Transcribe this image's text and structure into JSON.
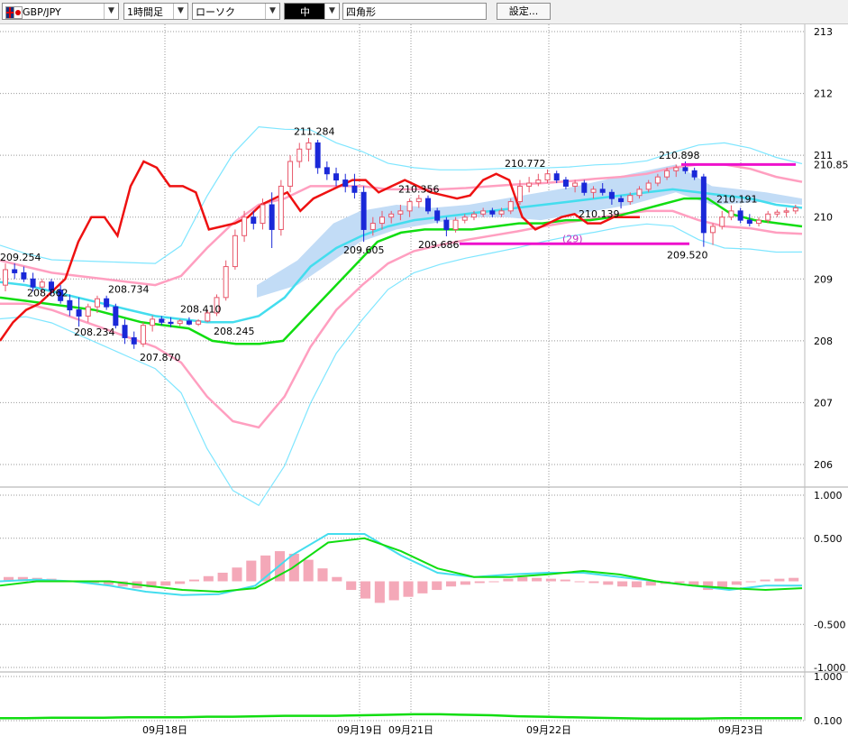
{
  "toolbar": {
    "symbol": "GBP/JPY",
    "timeframe": "1時間足",
    "chart_style": "ローソク",
    "draw_color_label": "中",
    "draw_shape": "四角形",
    "settings_label": "設定..."
  },
  "colors": {
    "candle_up": "#e8566a",
    "candle_down": "#1a28d8",
    "price_line": "#ee1111",
    "bollinger_outer": "#7fe6ff",
    "bollinger_inner": "#ff9fc0",
    "moving_average_long": "#11dd11",
    "moving_average_short": "#44ddee",
    "cloud": "#c2dcf6",
    "macd_histogram": "#f4a8b8",
    "marker_line": "#ee11cc"
  },
  "chart_data": [
    {
      "type": "line",
      "panel": "price",
      "ylim": [
        206,
        213
      ],
      "yticks": [
        "213",
        "212",
        "211",
        "210",
        "209",
        "208",
        "207",
        "206"
      ],
      "current_price_label": "210.85",
      "xticks": [
        "09月18日",
        "09月19日",
        "09月21日",
        "09月22日",
        "09月23日"
      ],
      "price_labels": [
        {
          "text": "209.254",
          "value": 209.254
        },
        {
          "text": "208.862",
          "value": 208.862
        },
        {
          "text": "208.734",
          "value": 208.734
        },
        {
          "text": "208.234",
          "value": 208.234
        },
        {
          "text": "208.410",
          "value": 208.41
        },
        {
          "text": "207.870",
          "value": 207.87
        },
        {
          "text": "208.245",
          "value": 208.245
        },
        {
          "text": "211.284",
          "value": 211.284
        },
        {
          "text": "209.605",
          "value": 209.605
        },
        {
          "text": "210.356",
          "value": 210.356
        },
        {
          "text": "209.686",
          "value": 209.686
        },
        {
          "text": "210.772",
          "value": 210.772
        },
        {
          "text": "210.139",
          "value": 210.139
        },
        {
          "text": "210.898",
          "value": 210.898
        },
        {
          "text": "209.520",
          "value": 209.52
        },
        {
          "text": "210.191",
          "value": 210.191
        }
      ],
      "annotation": "(29)",
      "horizontal_markers": [
        210.85,
        209.57
      ],
      "candles": [
        {
          "o": 208.9,
          "h": 209.25,
          "l": 208.8,
          "c": 209.15
        },
        {
          "o": 209.15,
          "h": 209.25,
          "l": 209.0,
          "c": 209.1
        },
        {
          "o": 209.1,
          "h": 209.2,
          "l": 208.95,
          "c": 209.0
        },
        {
          "o": 209.0,
          "h": 209.1,
          "l": 208.8,
          "c": 208.87
        },
        {
          "o": 208.87,
          "h": 209.0,
          "l": 208.78,
          "c": 208.95
        },
        {
          "o": 208.95,
          "h": 209.0,
          "l": 208.75,
          "c": 208.82
        },
        {
          "o": 208.82,
          "h": 208.9,
          "l": 208.6,
          "c": 208.65
        },
        {
          "o": 208.65,
          "h": 208.75,
          "l": 208.4,
          "c": 208.5
        },
        {
          "o": 208.5,
          "h": 208.7,
          "l": 208.23,
          "c": 208.4
        },
        {
          "o": 208.4,
          "h": 208.6,
          "l": 208.3,
          "c": 208.55
        },
        {
          "o": 208.55,
          "h": 208.73,
          "l": 208.45,
          "c": 208.68
        },
        {
          "o": 208.68,
          "h": 208.73,
          "l": 208.5,
          "c": 208.55
        },
        {
          "o": 208.55,
          "h": 208.6,
          "l": 208.2,
          "c": 208.25
        },
        {
          "o": 208.25,
          "h": 208.35,
          "l": 207.95,
          "c": 208.05
        },
        {
          "o": 208.05,
          "h": 208.15,
          "l": 207.87,
          "c": 207.95
        },
        {
          "o": 207.95,
          "h": 208.3,
          "l": 207.9,
          "c": 208.25
        },
        {
          "o": 208.25,
          "h": 208.41,
          "l": 208.15,
          "c": 208.35
        },
        {
          "o": 208.35,
          "h": 208.4,
          "l": 208.25,
          "c": 208.3
        },
        {
          "o": 208.3,
          "h": 208.38,
          "l": 208.22,
          "c": 208.28
        },
        {
          "o": 208.28,
          "h": 208.35,
          "l": 208.24,
          "c": 208.32
        },
        {
          "o": 208.32,
          "h": 208.38,
          "l": 208.25,
          "c": 208.27
        },
        {
          "o": 208.27,
          "h": 208.35,
          "l": 208.24,
          "c": 208.32
        },
        {
          "o": 208.32,
          "h": 208.5,
          "l": 208.3,
          "c": 208.45
        },
        {
          "o": 208.45,
          "h": 208.75,
          "l": 208.4,
          "c": 208.7
        },
        {
          "o": 208.7,
          "h": 209.3,
          "l": 208.65,
          "c": 209.2
        },
        {
          "o": 209.2,
          "h": 209.8,
          "l": 209.15,
          "c": 209.7
        },
        {
          "o": 209.7,
          "h": 210.1,
          "l": 209.6,
          "c": 210.0
        },
        {
          "o": 210.0,
          "h": 210.1,
          "l": 209.8,
          "c": 209.9
        },
        {
          "o": 209.9,
          "h": 210.3,
          "l": 209.8,
          "c": 210.2
        },
        {
          "o": 210.2,
          "h": 210.4,
          "l": 209.5,
          "c": 209.8
        },
        {
          "o": 209.8,
          "h": 210.6,
          "l": 209.7,
          "c": 210.5
        },
        {
          "o": 210.5,
          "h": 211.0,
          "l": 210.4,
          "c": 210.9
        },
        {
          "o": 210.9,
          "h": 211.2,
          "l": 210.8,
          "c": 211.1
        },
        {
          "o": 211.1,
          "h": 211.28,
          "l": 210.9,
          "c": 211.2
        },
        {
          "o": 211.2,
          "h": 211.25,
          "l": 210.7,
          "c": 210.8
        },
        {
          "o": 210.8,
          "h": 210.9,
          "l": 210.6,
          "c": 210.7
        },
        {
          "o": 210.7,
          "h": 210.8,
          "l": 210.5,
          "c": 210.6
        },
        {
          "o": 210.6,
          "h": 210.7,
          "l": 210.4,
          "c": 210.5
        },
        {
          "o": 210.5,
          "h": 210.7,
          "l": 210.3,
          "c": 210.4
        },
        {
          "o": 210.4,
          "h": 210.5,
          "l": 209.6,
          "c": 209.8
        },
        {
          "o": 209.8,
          "h": 210.0,
          "l": 209.7,
          "c": 209.9
        },
        {
          "o": 209.9,
          "h": 210.1,
          "l": 209.8,
          "c": 210.0
        },
        {
          "o": 210.0,
          "h": 210.1,
          "l": 209.9,
          "c": 210.05
        },
        {
          "o": 210.05,
          "h": 210.2,
          "l": 209.95,
          "c": 210.1
        },
        {
          "o": 210.1,
          "h": 210.3,
          "l": 210.0,
          "c": 210.25
        },
        {
          "o": 210.25,
          "h": 210.36,
          "l": 210.15,
          "c": 210.3
        },
        {
          "o": 210.3,
          "h": 210.35,
          "l": 210.05,
          "c": 210.1
        },
        {
          "o": 210.1,
          "h": 210.15,
          "l": 209.9,
          "c": 209.95
        },
        {
          "o": 209.95,
          "h": 210.0,
          "l": 209.69,
          "c": 209.8
        },
        {
          "o": 209.8,
          "h": 210.0,
          "l": 209.75,
          "c": 209.95
        },
        {
          "o": 209.95,
          "h": 210.05,
          "l": 209.9,
          "c": 210.0
        },
        {
          "o": 210.0,
          "h": 210.1,
          "l": 209.95,
          "c": 210.05
        },
        {
          "o": 210.05,
          "h": 210.15,
          "l": 210.0,
          "c": 210.1
        },
        {
          "o": 210.1,
          "h": 210.15,
          "l": 210.0,
          "c": 210.05
        },
        {
          "o": 210.05,
          "h": 210.15,
          "l": 210.0,
          "c": 210.1
        },
        {
          "o": 210.1,
          "h": 210.3,
          "l": 210.05,
          "c": 210.25
        },
        {
          "o": 210.25,
          "h": 210.6,
          "l": 210.2,
          "c": 210.5
        },
        {
          "o": 210.5,
          "h": 210.65,
          "l": 210.4,
          "c": 210.55
        },
        {
          "o": 210.55,
          "h": 210.7,
          "l": 210.5,
          "c": 210.6
        },
        {
          "o": 210.6,
          "h": 210.77,
          "l": 210.55,
          "c": 210.7
        },
        {
          "o": 210.7,
          "h": 210.75,
          "l": 210.55,
          "c": 210.6
        },
        {
          "o": 210.6,
          "h": 210.65,
          "l": 210.45,
          "c": 210.5
        },
        {
          "o": 210.5,
          "h": 210.6,
          "l": 210.4,
          "c": 210.55
        },
        {
          "o": 210.55,
          "h": 210.6,
          "l": 210.35,
          "c": 210.4
        },
        {
          "o": 210.4,
          "h": 210.5,
          "l": 210.3,
          "c": 210.45
        },
        {
          "o": 210.45,
          "h": 210.55,
          "l": 210.35,
          "c": 210.4
        },
        {
          "o": 210.4,
          "h": 210.45,
          "l": 210.2,
          "c": 210.3
        },
        {
          "o": 210.3,
          "h": 210.35,
          "l": 210.14,
          "c": 210.25
        },
        {
          "o": 210.25,
          "h": 210.4,
          "l": 210.2,
          "c": 210.35
        },
        {
          "o": 210.35,
          "h": 210.5,
          "l": 210.3,
          "c": 210.45
        },
        {
          "o": 210.45,
          "h": 210.6,
          "l": 210.4,
          "c": 210.55
        },
        {
          "o": 210.55,
          "h": 210.7,
          "l": 210.5,
          "c": 210.65
        },
        {
          "o": 210.65,
          "h": 210.8,
          "l": 210.6,
          "c": 210.75
        },
        {
          "o": 210.75,
          "h": 210.85,
          "l": 210.65,
          "c": 210.8
        },
        {
          "o": 210.8,
          "h": 210.9,
          "l": 210.7,
          "c": 210.75
        },
        {
          "o": 210.75,
          "h": 210.8,
          "l": 210.6,
          "c": 210.65
        },
        {
          "o": 210.65,
          "h": 210.7,
          "l": 209.52,
          "c": 209.75
        },
        {
          "o": 209.75,
          "h": 209.9,
          "l": 209.55,
          "c": 209.85
        },
        {
          "o": 209.85,
          "h": 210.1,
          "l": 209.8,
          "c": 210.0
        },
        {
          "o": 210.0,
          "h": 210.19,
          "l": 209.95,
          "c": 210.1
        },
        {
          "o": 210.1,
          "h": 210.15,
          "l": 209.9,
          "c": 209.95
        },
        {
          "o": 209.95,
          "h": 210.05,
          "l": 209.85,
          "c": 209.9
        },
        {
          "o": 209.9,
          "h": 210.0,
          "l": 209.85,
          "c": 209.95
        },
        {
          "o": 209.95,
          "h": 210.1,
          "l": 209.9,
          "c": 210.05
        },
        {
          "o": 210.05,
          "h": 210.12,
          "l": 210.0,
          "c": 210.08
        },
        {
          "o": 210.08,
          "h": 210.15,
          "l": 210.0,
          "c": 210.1
        },
        {
          "o": 210.1,
          "h": 210.2,
          "l": 210.05,
          "c": 210.15
        }
      ],
      "series": [
        {
          "color": "#ee1111",
          "values": [
            208.0,
            208.3,
            208.5,
            208.6,
            208.8,
            209.0,
            209.6,
            210.0,
            210.0,
            209.7,
            210.5,
            210.9,
            210.8,
            210.5,
            210.5,
            210.4,
            209.8,
            209.85,
            209.9,
            210.0,
            210.2,
            210.3,
            210.4,
            210.1,
            210.3,
            210.4,
            210.5,
            210.6,
            210.6,
            210.4,
            210.5,
            210.6,
            210.5,
            210.4,
            210.35,
            210.3,
            210.35,
            210.6,
            210.7,
            210.6,
            210.0,
            209.8,
            209.9,
            210.0,
            210.05,
            209.9,
            209.9,
            210.0,
            210.0,
            210.0
          ]
        },
        {
          "color": "#11dd11",
          "values": [
            208.7,
            208.65,
            208.6,
            208.55,
            208.5,
            208.4,
            208.3,
            208.25,
            208.2,
            208.0,
            207.95,
            207.95,
            208.0,
            208.4,
            208.8,
            209.2,
            209.6,
            209.75,
            209.8,
            209.8,
            209.8,
            209.85,
            209.9,
            209.9,
            209.95,
            209.95,
            210.0,
            210.1,
            210.2,
            210.3,
            210.3,
            210.05,
            209.95,
            209.9,
            209.85
          ]
        },
        {
          "color": "#44ddee",
          "values": [
            208.95,
            208.9,
            208.8,
            208.7,
            208.6,
            208.5,
            208.4,
            208.35,
            208.3,
            208.3,
            208.4,
            208.7,
            209.2,
            209.5,
            209.7,
            209.85,
            209.95,
            210.0,
            210.05,
            210.1,
            210.15,
            210.2,
            210.25,
            210.3,
            210.35,
            210.4,
            210.45,
            210.4,
            210.35,
            210.3,
            210.2,
            210.15
          ]
        }
      ]
    },
    {
      "type": "line",
      "panel": "oscillator",
      "ylim": [
        -1.0,
        1.0
      ],
      "yticks": [
        "1.000",
        "0.500",
        "-0.500",
        "-1.000"
      ],
      "series": [
        {
          "color": "#44ddee",
          "values": [
            0.0,
            0.02,
            0.0,
            -0.05,
            -0.12,
            -0.16,
            -0.15,
            -0.05,
            0.3,
            0.55,
            0.55,
            0.3,
            0.1,
            0.05,
            0.08,
            0.1,
            0.1,
            0.05,
            0.0,
            -0.05,
            -0.1,
            -0.05,
            -0.05
          ]
        },
        {
          "color": "#11dd11",
          "values": [
            -0.05,
            0.0,
            0.0,
            0.0,
            -0.05,
            -0.1,
            -0.12,
            -0.08,
            0.15,
            0.45,
            0.5,
            0.35,
            0.15,
            0.05,
            0.05,
            0.08,
            0.12,
            0.08,
            0.0,
            -0.05,
            -0.08,
            -0.1,
            -0.08
          ]
        }
      ],
      "histogram": [
        0.05,
        0.05,
        0.04,
        0.03,
        0.01,
        0.0,
        -0.02,
        -0.04,
        -0.06,
        -0.08,
        -0.07,
        -0.05,
        -0.03,
        0.02,
        0.06,
        0.1,
        0.16,
        0.24,
        0.3,
        0.35,
        0.32,
        0.25,
        0.15,
        0.05,
        -0.1,
        -0.2,
        -0.25,
        -0.22,
        -0.18,
        -0.14,
        -0.1,
        -0.06,
        -0.04,
        -0.02,
        0.0,
        0.03,
        0.05,
        0.04,
        0.03,
        0.02,
        0.0,
        -0.02,
        -0.04,
        -0.06,
        -0.07,
        -0.05,
        -0.03,
        -0.02,
        -0.05,
        -0.1,
        -0.08,
        -0.04,
        0.0,
        0.02,
        0.03,
        0.04
      ]
    },
    {
      "type": "line",
      "panel": "volume",
      "ylim": [
        0.1,
        1.0
      ],
      "yticks": [
        "1.000",
        "0.100"
      ],
      "series": [
        {
          "color": "#11dd11",
          "values": [
            0.15,
            0.15,
            0.16,
            0.16,
            0.16,
            0.17,
            0.17,
            0.17,
            0.18,
            0.18,
            0.19,
            0.2,
            0.2,
            0.2,
            0.21,
            0.22,
            0.23,
            0.23,
            0.22,
            0.21,
            0.19,
            0.18,
            0.17,
            0.16,
            0.15,
            0.14,
            0.14,
            0.14,
            0.15,
            0.15,
            0.15,
            0.15
          ]
        }
      ]
    }
  ]
}
